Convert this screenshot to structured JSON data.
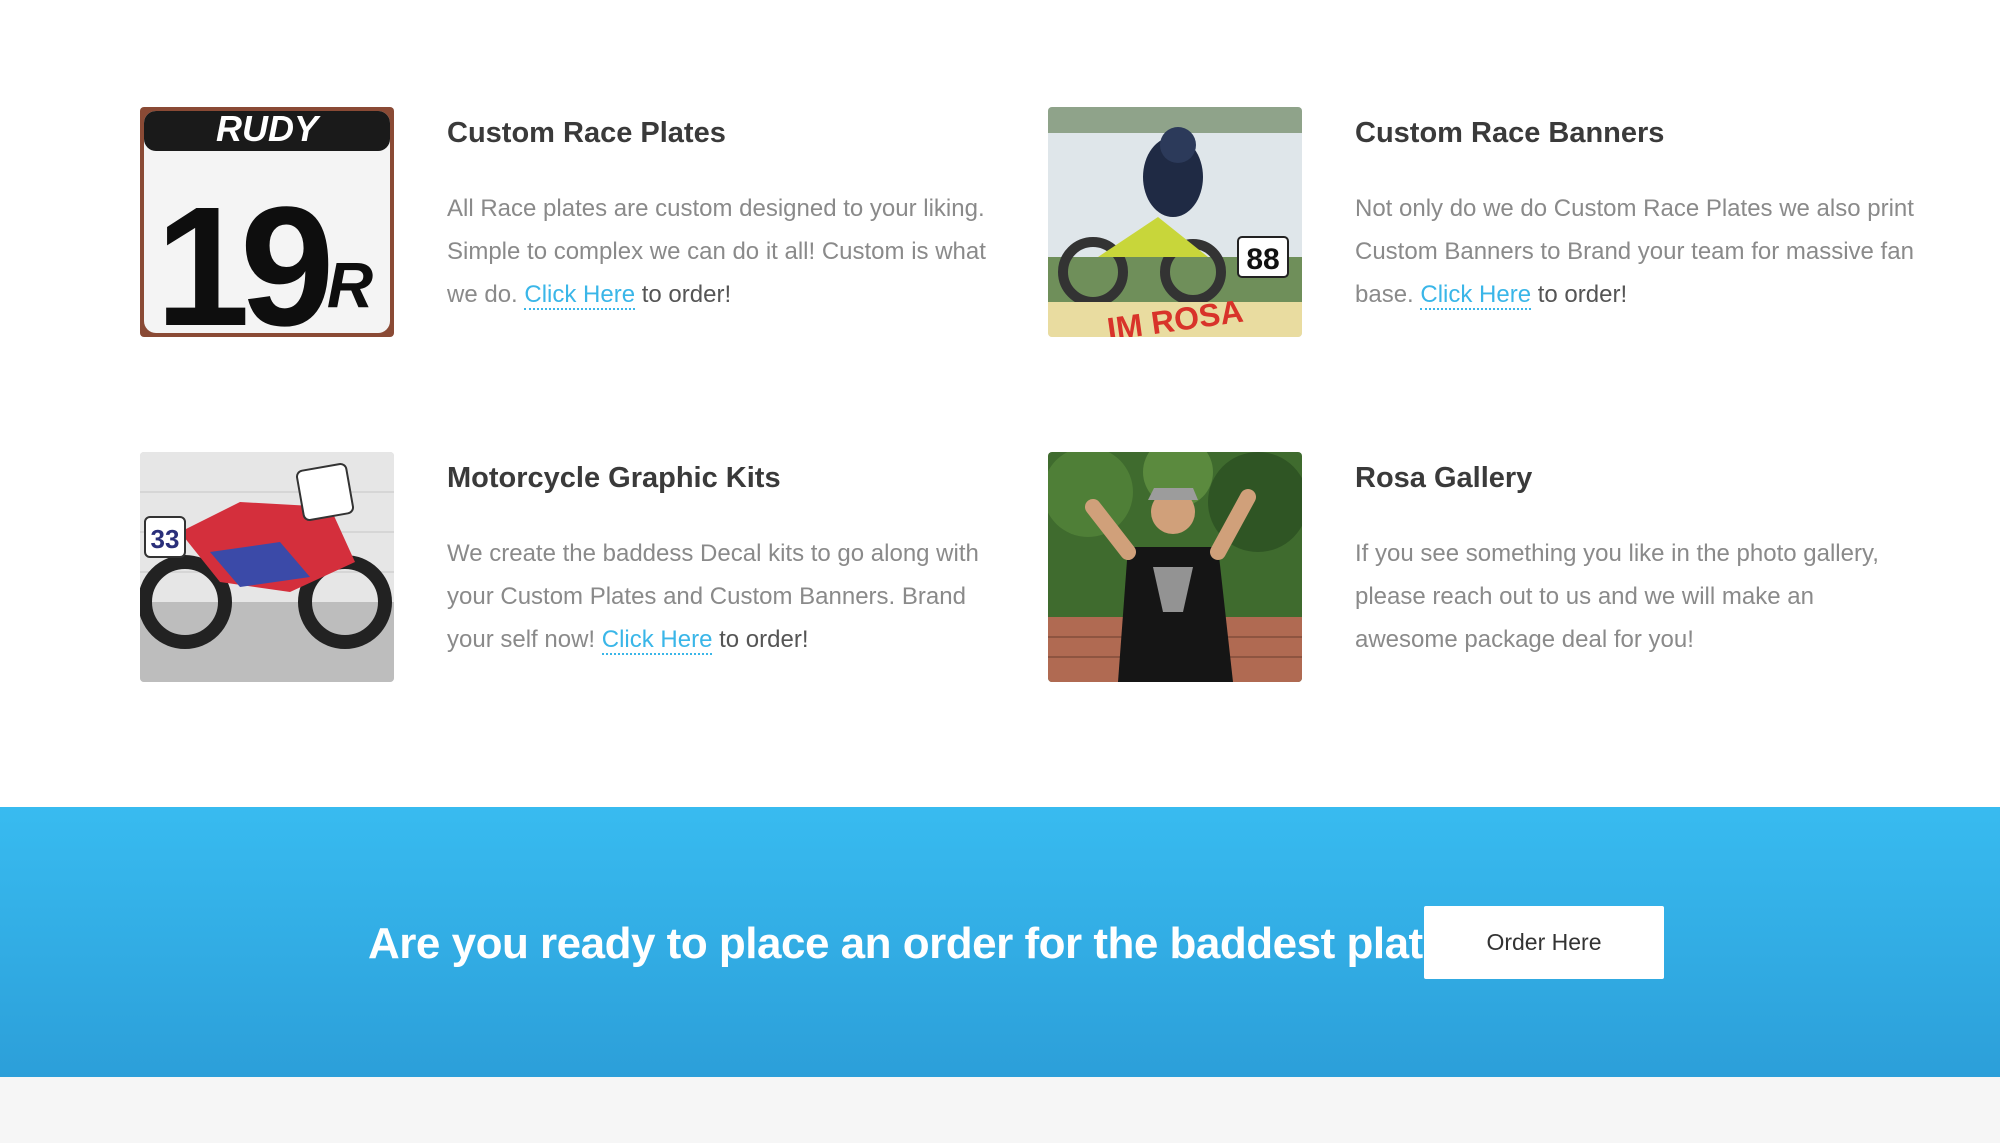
{
  "services": [
    {
      "title": "Custom Race Plates",
      "body": "All Race plates are custom designed to your liking. Simple to complex we can do it all! Custom is what we do.",
      "link_label": "Click Here",
      "suffix": "to order!",
      "image_text": {
        "brand": "RUDY",
        "number": "19",
        "suffix_letter": "R"
      }
    },
    {
      "title": "Custom Race Banners",
      "body": "Not only do we do Custom Race Plates we also print Custom Banners to Brand your team for massive fan base.",
      "link_label": "Click Here",
      "suffix": "to order!",
      "image_text": {
        "plate_number": "88",
        "name": "IM ROSA"
      }
    },
    {
      "title": "Motorcycle Graphic Kits",
      "body": "We create the baddess Decal kits to go along with your Custom Plates and Custom Banners. Brand your self now!",
      "link_label": "Click Here",
      "suffix": "to order!",
      "image_text": {
        "plate_number": "33"
      }
    },
    {
      "title": "Rosa Gallery",
      "body": "If you see something you like in the photo gallery, please reach out to us and we will make an awesome package deal for you!",
      "link_label": "",
      "suffix": ""
    }
  ],
  "cta": {
    "text": "Are you ready to place an order for the baddest plates?",
    "button_label": "Order Here"
  },
  "colors": {
    "accent_link": "#3ab6e8",
    "cta_band_top": "#38bbf0",
    "cta_band_bottom": "#2c9fd9"
  }
}
